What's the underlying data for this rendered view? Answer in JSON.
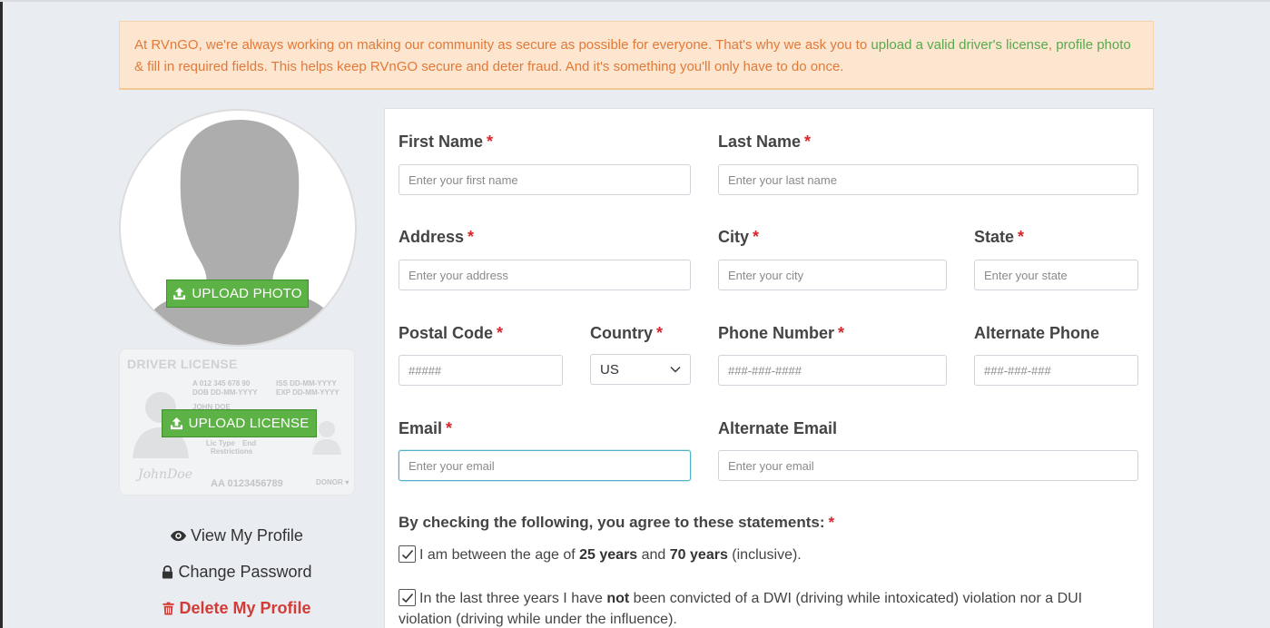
{
  "notice": {
    "text_1": "At RVnGO, we're always working on making our community as secure as possible for everyone. That's why we ask you to ",
    "link_license": "upload a valid driver's license",
    "text_2": ",",
    "link_photo": "profile photo",
    "text_3": " & fill in required fields. This helps keep RVnGO secure and deter fraud. And it's something you'll only have to do once."
  },
  "sidebar": {
    "upload_photo_label": "UPLOAD PHOTO",
    "upload_license_label": "UPLOAD LICENSE",
    "license_card": {
      "title": "DRIVER LICENSE",
      "id_line": "A 012 345 678 90",
      "dob": "DOB DD-MM-YYYY",
      "iss": "ISS DD-MM-YYYY",
      "exp": "EXP DD-MM-YYYY",
      "name": "JOHN DOE",
      "lic_type": "Lic Type",
      "end": "End",
      "restrictions": "Restrictions",
      "signature": "JohnDoe",
      "number": "AA 0123456789",
      "donor": "DONOR ♥"
    },
    "links": {
      "view_profile": "View My Profile",
      "change_password": "Change Password",
      "delete_profile": "Delete My Profile"
    }
  },
  "form": {
    "required_mark": "*",
    "first_name": {
      "label": "First Name",
      "placeholder": "Enter your first name",
      "value": ""
    },
    "last_name": {
      "label": "Last Name",
      "placeholder": "Enter your last name",
      "value": ""
    },
    "address": {
      "label": "Address",
      "placeholder": "Enter your address",
      "value": ""
    },
    "city": {
      "label": "City",
      "placeholder": "Enter your city",
      "value": ""
    },
    "state": {
      "label": "State",
      "placeholder": "Enter your state",
      "value": ""
    },
    "postal_code": {
      "label": "Postal Code",
      "placeholder": "#####",
      "value": ""
    },
    "country": {
      "label": "Country",
      "selected": "US"
    },
    "phone": {
      "label": "Phone Number",
      "placeholder": "###-###-####",
      "value": ""
    },
    "alt_phone": {
      "label": "Alternate Phone",
      "placeholder": "###-###-###",
      "value": ""
    },
    "email": {
      "label": "Email",
      "placeholder": "Enter your email",
      "value": ""
    },
    "alt_email": {
      "label": "Alternate Email",
      "placeholder": "Enter your email",
      "value": ""
    },
    "agreements": {
      "heading": "By checking the following, you agree to these statements:",
      "age": {
        "checked": true,
        "t1": "I am between the age of ",
        "b1": "25 years",
        "t2": " and ",
        "b2": "70 years",
        "t3": " (inclusive)."
      },
      "dwi": {
        "checked": true,
        "t1": "In the last three years I have ",
        "b1": "not",
        "t2": " been convicted of a DWI (driving while intoxicated) violation nor a DUI violation (driving while under the influence)."
      }
    }
  },
  "colors": {
    "notice_text": "#e2793a",
    "notice_link": "#58a94d",
    "notice_bg": "#fde6cf",
    "button_green": "#5cb245",
    "required_red": "#d9262e",
    "delete_red": "#d33b36",
    "focus_border": "#4db3c9"
  },
  "icons": {
    "upload": "upload-icon",
    "eye": "eye-icon",
    "lock": "lock-icon",
    "trash": "trash-icon",
    "chevron": "chevron-down-icon",
    "check": "checkmark-icon"
  }
}
